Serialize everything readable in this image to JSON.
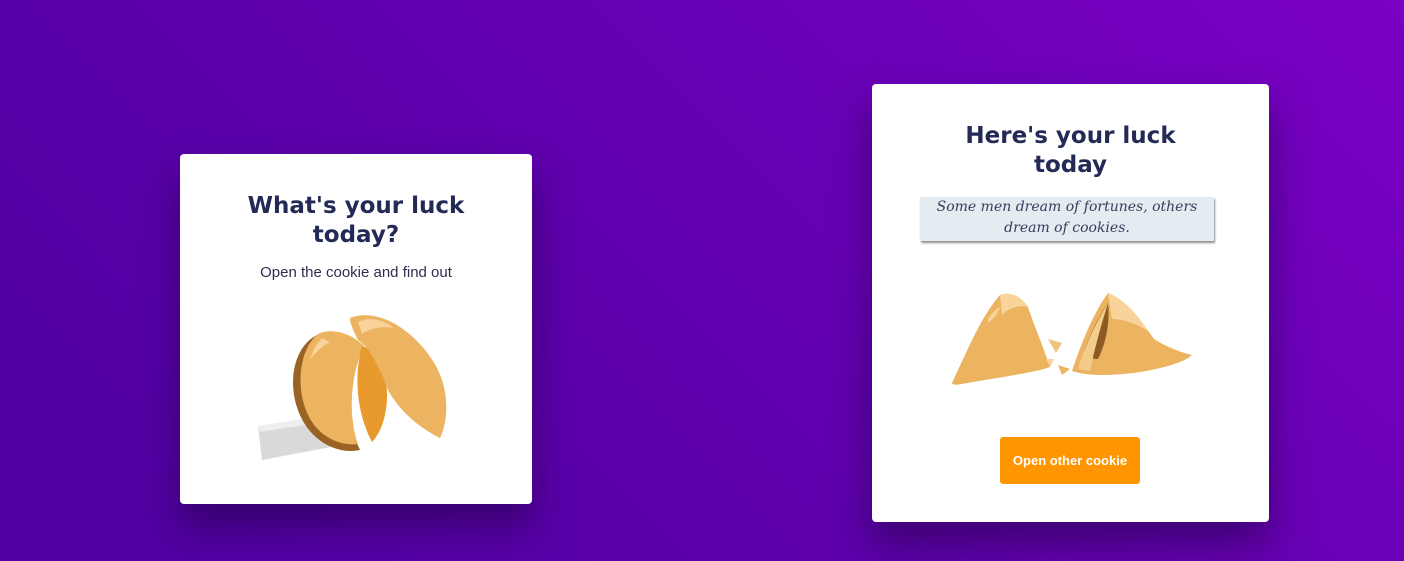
{
  "left_card": {
    "title": "What's your luck today?",
    "subtitle": "Open the cookie and find out"
  },
  "right_card": {
    "title": "Here's your luck today",
    "fortune": "Some men dream of fortunes, others dream of cookies.",
    "button_label": "Open other cookie"
  },
  "icons": {
    "whole_cookie": "fortune-cookie-closed-icon",
    "broken_cookie": "fortune-cookie-opened-icon"
  },
  "colors": {
    "background_start": "#4e00a0",
    "background_end": "#7a00c4",
    "title_text": "#232a56",
    "button": "#ff9500",
    "cookie": "#ecb360",
    "cookie_dark": "#d38a2a",
    "fortune_paper": "#e4ebf1"
  }
}
